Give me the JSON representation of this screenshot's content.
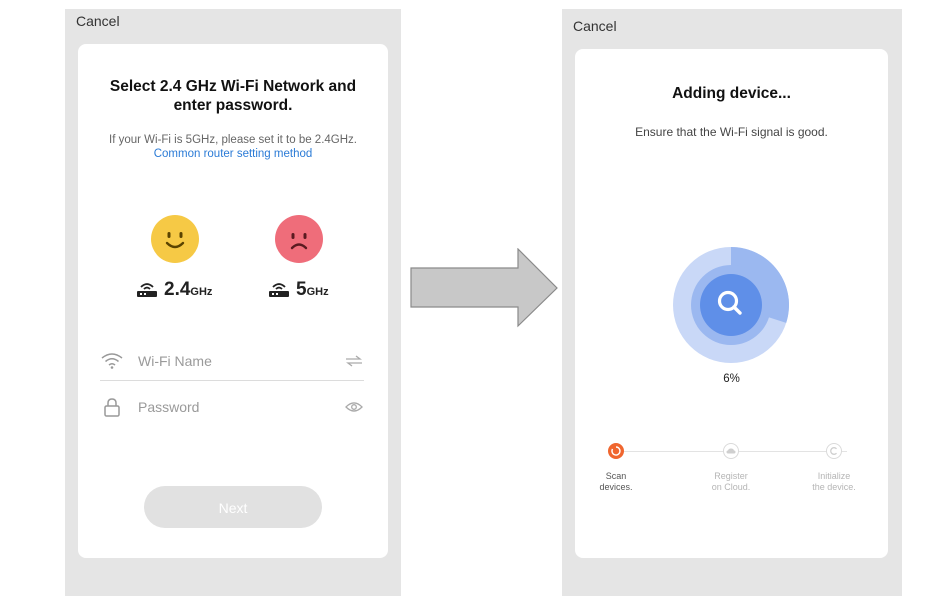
{
  "left_screen": {
    "cancel_label": "Cancel",
    "title": "Select 2.4 GHz Wi-Fi Network and enter password.",
    "subtitle_text": "If your Wi-Fi is 5GHz, please set it to be 2.4GHz.",
    "subtitle_link": "Common router setting method",
    "band_24": {
      "number": "2.4",
      "unit": "GHz"
    },
    "band_5": {
      "number": "5",
      "unit": "GHz"
    },
    "wifi_name_placeholder": "Wi-Fi Name",
    "password_placeholder": "Password",
    "next_label": "Next"
  },
  "right_screen": {
    "cancel_label": "Cancel",
    "title": "Adding device...",
    "subtitle": "Ensure that the Wi-Fi signal is good.",
    "progress_percent": 6,
    "progress_label": "6%",
    "steps": [
      {
        "line1": "Scan",
        "line2": "devices.",
        "active": true
      },
      {
        "line1": "Register",
        "line2": "on Cloud.",
        "active": false
      },
      {
        "line1": "Initialize",
        "line2": "the device.",
        "active": false
      }
    ]
  },
  "colors": {
    "accent_link": "#2b7bd6",
    "happy_face": "#f6c945",
    "sad_face": "#ef6d7a",
    "progress_blue": "#5f8fe8",
    "step_active": "#f0662f"
  }
}
